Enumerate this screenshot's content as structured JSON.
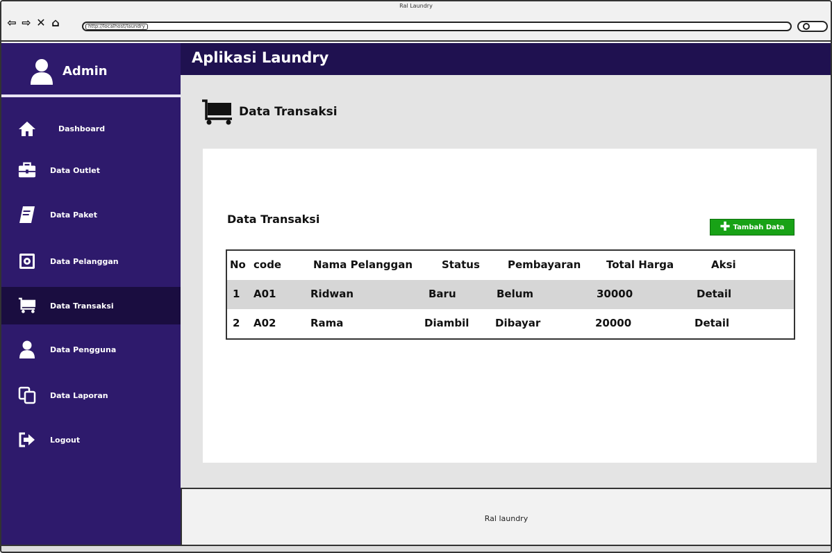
{
  "window": {
    "title": "Ral Laundry",
    "url": "http://localhost/laundry",
    "nav": {
      "back": "⇦",
      "forward": "⇨",
      "stop": "✕",
      "home": "⌂"
    }
  },
  "sidebar": {
    "user_label": "Admin",
    "items": [
      {
        "label": "Dashboard",
        "icon": "home-icon"
      },
      {
        "label": "Data Outlet",
        "icon": "briefcase-icon"
      },
      {
        "label": "Data Paket",
        "icon": "book-icon"
      },
      {
        "label": "Data Pelanggan",
        "icon": "safe-icon"
      },
      {
        "label": "Data Transaksi",
        "icon": "cart-icon",
        "active": true
      },
      {
        "label": "Data Pengguna",
        "icon": "user-icon"
      },
      {
        "label": "Data Laporan",
        "icon": "copy-icon"
      },
      {
        "label": "Logout",
        "icon": "logout-icon"
      }
    ]
  },
  "main": {
    "app_title": "Aplikasi Laundry",
    "page_title": "Data Transaksi",
    "card_title": "Data Transaksi",
    "add_button": "Tambah Data",
    "table": {
      "headers": [
        "No",
        "code",
        "Nama Pelanggan",
        "Status",
        "Pembayaran",
        "Total Harga",
        "Aksi"
      ],
      "rows": [
        [
          "1",
          "A01",
          "Ridwan",
          "Baru",
          "Belum",
          "30000",
          "Detail"
        ],
        [
          "2",
          "A02",
          "Rama",
          "Diambil",
          "Dibayar",
          "20000",
          "Detail"
        ]
      ]
    },
    "footer": "Ral laundry"
  },
  "colors": {
    "sidebar": "#2e1a6c",
    "topbar": "#1f1150",
    "active_item": "#1a0d40",
    "add_button": "#18a216",
    "content_bg": "#e4e4e4"
  }
}
